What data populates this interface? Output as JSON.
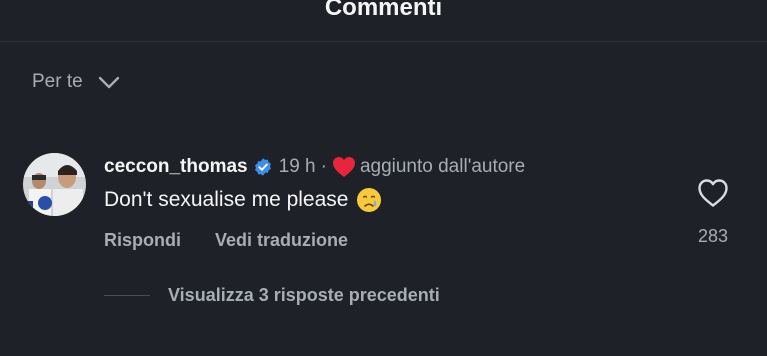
{
  "header": {
    "title": "Commenti"
  },
  "filter": {
    "label": "Per te",
    "icon": "chevron-down-icon"
  },
  "comment": {
    "username": "ceccon_thomas",
    "verified": true,
    "time": "19 h",
    "separator": "·",
    "author_liked_label": "aggiunto dall'autore",
    "text": "Don't sexualise me please",
    "emoji": "crying-face",
    "reply_label": "Rispondi",
    "translate_label": "Vedi traduzione",
    "like_count": "283",
    "view_replies_label": "Visualizza 3 risposte precedenti"
  },
  "colors": {
    "background": "#1e2127",
    "text_primary": "#f5f5f5",
    "text_secondary": "#a8acb3",
    "verified_blue": "#3b8fe8",
    "heart_red": "#e8253c"
  }
}
